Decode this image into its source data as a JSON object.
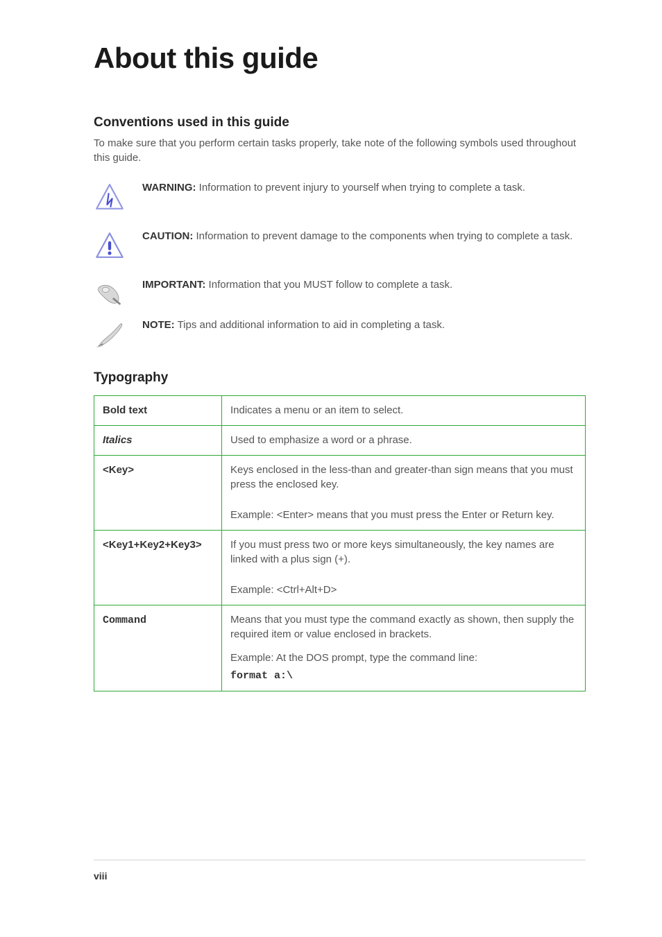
{
  "title": "About this guide",
  "conventions": {
    "heading": "Conventions used in this guide",
    "sub": "To make sure that you perform certain tasks properly, take note of the following symbols used throughout this guide.",
    "items": [
      {
        "label": "WARNING:",
        "text": " Information to prevent injury to yourself when trying to complete a task."
      },
      {
        "label": "CAUTION:",
        "text": " Information to prevent damage to the components when trying to complete a task."
      },
      {
        "label": "IMPORTANT:",
        "text": " Information that you MUST follow to complete a task."
      },
      {
        "label": "NOTE:",
        "text": " Tips and additional information to aid in completing a task."
      }
    ]
  },
  "typography": {
    "heading": "Typography",
    "rows": [
      {
        "term": "Bold text",
        "desc": "Indicates a menu or an item to select."
      },
      {
        "term": "Italics",
        "desc": "Used to emphasize a word or a phrase.",
        "italic": true
      },
      {
        "term": "<Key>",
        "desc": "Keys enclosed in the less-than and greater-than sign means that you must press the enclosed key.\n\nExample: <Enter> means that you must press the Enter or Return key."
      },
      {
        "term": "<Key1+Key2+Key3>",
        "desc": "If you must press two or more keys simultaneously, the key names are linked with a plus sign (+).\n\nExample: <Ctrl+Alt+D>"
      },
      {
        "term_mono": "Command",
        "desc_pre": "Means that you must type the command exactly as shown, then supply the required item or value enclosed in brackets.",
        "desc_ex_label": "Example: At the DOS prompt, type the command line:",
        "desc_ex_cmd": "format a:\\"
      }
    ]
  },
  "footer": {
    "page_num": "viii"
  }
}
